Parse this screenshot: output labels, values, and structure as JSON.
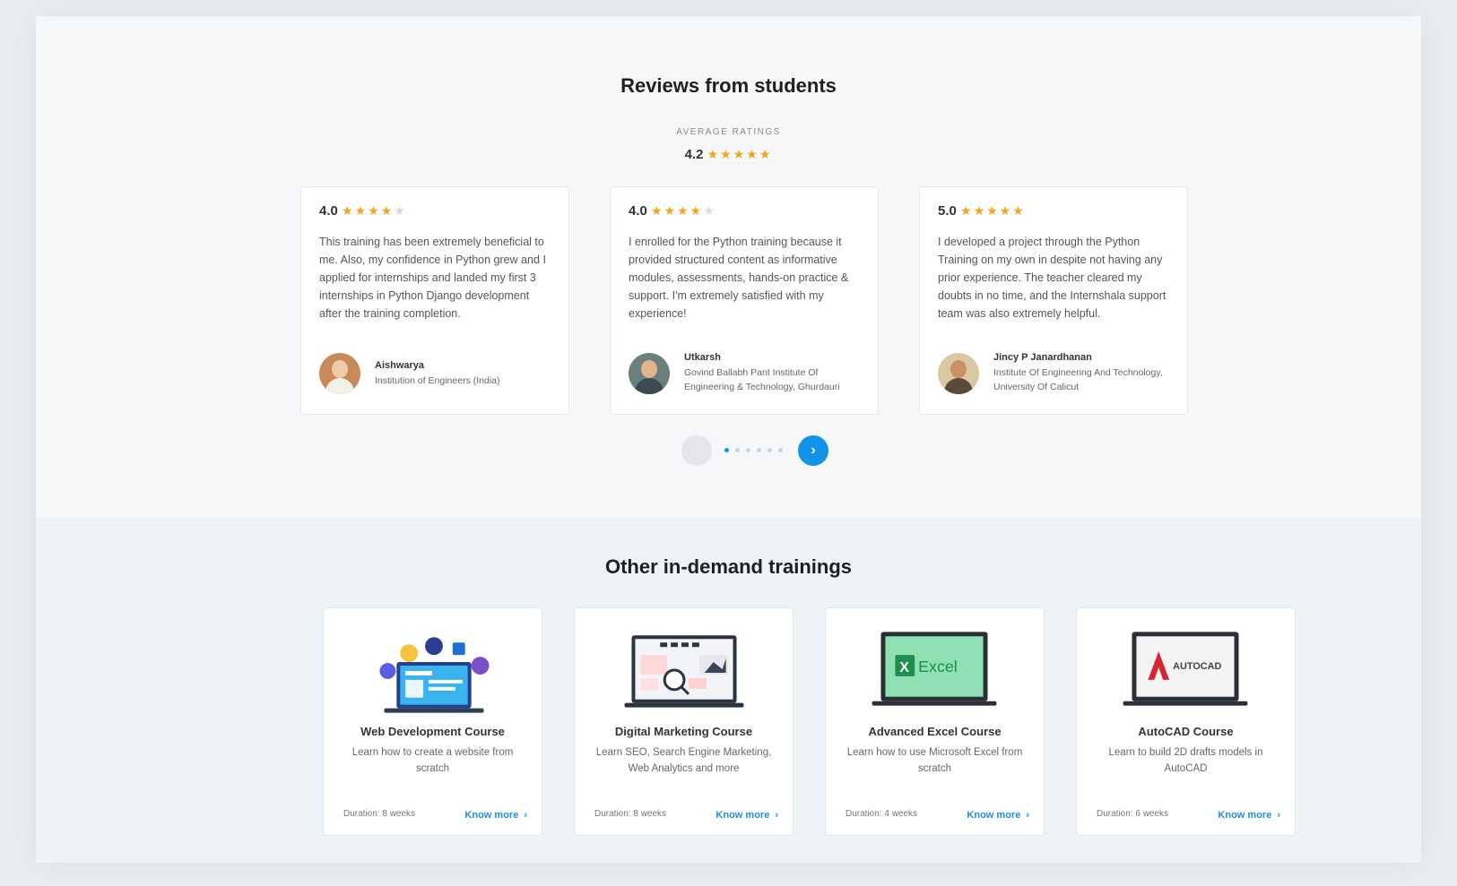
{
  "reviews": {
    "title": "Reviews from students",
    "average_label": "AVERAGE RATINGS",
    "average_value": "4.2",
    "average_stars": "★★★★★",
    "cards": [
      {
        "rating": "4.0",
        "stars_on": "★★★★",
        "stars_off": "★",
        "text": "This training has been extremely beneficial to me. Also, my confidence in Python grew and I applied for internships and landed my first 3 internships in Python Django development after the training completion.",
        "author": "Aishwarya",
        "institute": "Institution of Engineers (India)"
      },
      {
        "rating": "4.0",
        "stars_on": "★★★★",
        "stars_off": "★",
        "text": "I enrolled for the Python training because it provided structured content as informative modules, assessments, hands-on practice & support. I'm extremely satisfied with my experience!",
        "author": "Utkarsh",
        "institute": "Govind Ballabh Pant Institute Of Engineering & Technology, Ghurdauri"
      },
      {
        "rating": "5.0",
        "stars_on": "★★★★★",
        "stars_off": "",
        "text": "I developed a project through the Python Training on my own in despite not having any prior experience. The teacher cleared my doubts in no time, and the Internshala support team was also extremely helpful.",
        "author": "Jincy P Janardhanan",
        "institute": "Institute Of Engineering And Technology, University Of Calicut"
      }
    ]
  },
  "carousel": {
    "prev_icon": "chevron-left-icon",
    "next_icon": "chevron-right-icon",
    "next_glyph": "›",
    "dot_count": 6,
    "active_dot": 0
  },
  "trainings": {
    "title": "Other in-demand trainings",
    "courses": [
      {
        "name": "Web Development Course",
        "description": "Learn how to create a website from scratch",
        "duration": "Duration: 8 weeks",
        "link": "Know more",
        "icon": "laptop-web-icon"
      },
      {
        "name": "Digital Marketing Course",
        "description": "Learn SEO, Search Engine Marketing, Web Analytics and more",
        "duration": "Duration: 8 weeks",
        "link": "Know more",
        "icon": "marketing-dashboard-icon"
      },
      {
        "name": "Advanced Excel Course",
        "description": "Learn how to use Microsoft Excel from scratch",
        "duration": "Duration: 4 weeks",
        "link": "Know more",
        "icon": "excel-laptop-icon",
        "icon_label": "Excel"
      },
      {
        "name": "AutoCAD Course",
        "description": "Learn to build 2D drafts models in AutoCAD",
        "duration": "Duration: 6 weeks",
        "link": "Know more",
        "icon": "autocad-laptop-icon",
        "icon_label": "AUTOCAD"
      }
    ]
  },
  "colors": {
    "accent": "#1295e8",
    "star": "#f4a51c",
    "excel_green": "#1f8f4e",
    "autocad_red": "#d8262f"
  }
}
